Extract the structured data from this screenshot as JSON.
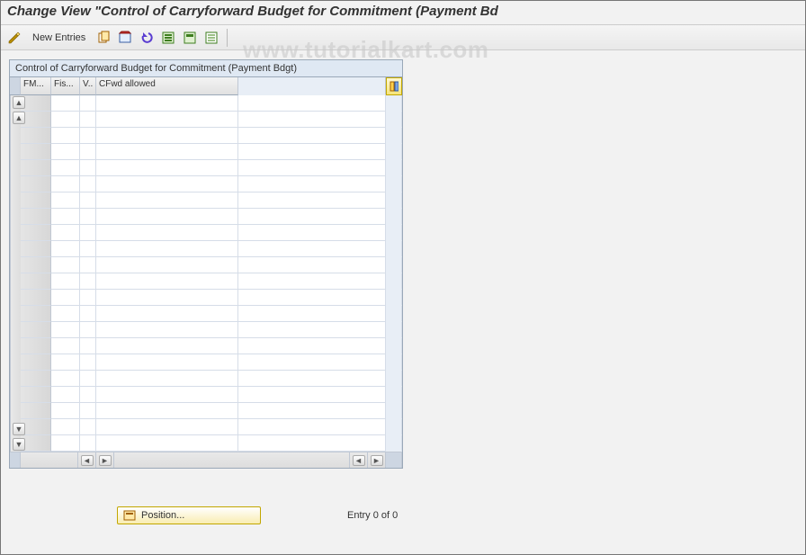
{
  "window": {
    "title": "Change View \"Control of Carryforward Budget for Commitment (Payment Bd"
  },
  "toolbar": {
    "new_entries_label": "New Entries"
  },
  "panel": {
    "title": "Control of Carryforward Budget for Commitment (Payment Bdgt)",
    "columns": {
      "c1": "FM...",
      "c2": "Fis...",
      "c3": "V..",
      "c4": "CFwd allowed"
    },
    "rows": [
      {},
      {},
      {},
      {},
      {},
      {},
      {},
      {},
      {},
      {},
      {},
      {},
      {},
      {},
      {},
      {},
      {},
      {},
      {},
      {},
      {},
      {}
    ]
  },
  "footer": {
    "position_label": "Position...",
    "entry_text": "Entry 0 of 0"
  },
  "watermark": "www.tutorialkart.com"
}
